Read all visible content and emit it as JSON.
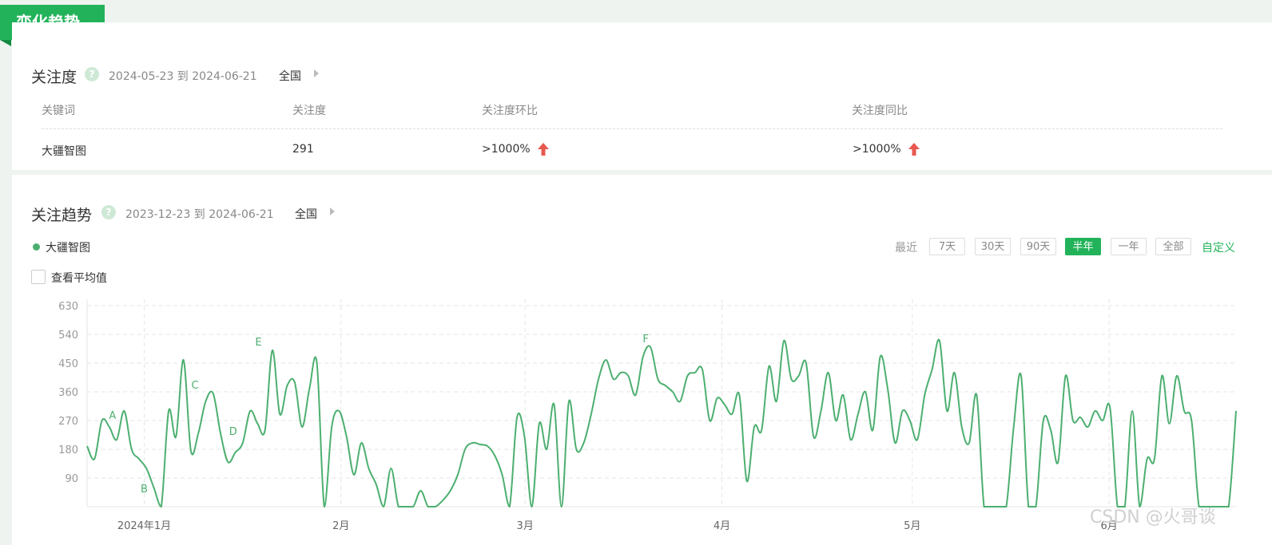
{
  "section_tag": "变化趋势",
  "attention": {
    "title": "关注度",
    "date_range": "2024-05-23 到 2024-06-21",
    "region": "全国",
    "columns": [
      "关键词",
      "关注度",
      "关注度环比",
      "关注度同比"
    ],
    "row": {
      "keyword": "大疆智图",
      "value": "291",
      "mom": ">1000%",
      "yoy": ">1000%"
    }
  },
  "trend": {
    "title": "关注趋势",
    "date_range": "2023-12-23 到 2024-06-21",
    "region": "全国",
    "legend": "大疆智图",
    "show_average_label": "查看平均值",
    "range_label": "最近",
    "range_buttons": [
      "7天",
      "30天",
      "90天",
      "半年",
      "一年",
      "全部"
    ],
    "active_range": "半年",
    "custom_label": "自定义"
  },
  "colors": {
    "brand": "#22b35a",
    "line": "#4caf70",
    "up_arrow": "#e8584f"
  },
  "watermark": "CSDN @火哥谈",
  "chart_data": {
    "type": "line",
    "x_range": [
      "2023-12-23",
      "2024-06-21"
    ],
    "ylim": [
      0,
      630
    ],
    "yticks": [
      90,
      180,
      270,
      360,
      450,
      540,
      630
    ],
    "xtick_labels": [
      {
        "date": "2024-01-01",
        "label": "2024年1月"
      },
      {
        "date": "2024-02-01",
        "label": "2月"
      },
      {
        "date": "2024-03-01",
        "label": "3月"
      },
      {
        "date": "2024-04-01",
        "label": "4月"
      },
      {
        "date": "2024-05-01",
        "label": "5月"
      },
      {
        "date": "2024-06-01",
        "label": "6月"
      }
    ],
    "grid": true,
    "series": [
      {
        "name": "大疆智图",
        "values": [
          190,
          150,
          270,
          250,
          210,
          300,
          180,
          150,
          120,
          60,
          0,
          300,
          220,
          460,
          175,
          230,
          330,
          355,
          230,
          140,
          170,
          200,
          300,
          260,
          240,
          490,
          290,
          380,
          390,
          250,
          370,
          450,
          0,
          250,
          300,
          220,
          100,
          200,
          120,
          70,
          0,
          120,
          0,
          0,
          0,
          50,
          0,
          0,
          20,
          50,
          100,
          180,
          200,
          195,
          190,
          160,
          100,
          0,
          280,
          220,
          0,
          260,
          180,
          320,
          0,
          330,
          180,
          200,
          290,
          400,
          460,
          400,
          420,
          410,
          350,
          470,
          500,
          400,
          380,
          360,
          330,
          410,
          420,
          430,
          270,
          340,
          320,
          290,
          350,
          80,
          250,
          240,
          440,
          330,
          520,
          400,
          410,
          450,
          220,
          300,
          420,
          270,
          350,
          210,
          290,
          360,
          240,
          470,
          370,
          200,
          300,
          270,
          210,
          350,
          430,
          520,
          300,
          420,
          250,
          200,
          350,
          0,
          0,
          0,
          0,
          250,
          410,
          0,
          0,
          270,
          240,
          140,
          410,
          270,
          280,
          250,
          300,
          270,
          310,
          0,
          0,
          300,
          0,
          150,
          150,
          410,
          260,
          410,
          300,
          270,
          0,
          0,
          0,
          0,
          0,
          300
        ]
      }
    ],
    "annotations": [
      {
        "label": "A",
        "x": "2023-12-27",
        "y": 260
      },
      {
        "label": "B",
        "x": "2024-01-01",
        "y": 30
      },
      {
        "label": "C",
        "x": "2024-01-09",
        "y": 355
      },
      {
        "label": "D",
        "x": "2024-01-15",
        "y": 210
      },
      {
        "label": "E",
        "x": "2024-01-19",
        "y": 490
      },
      {
        "label": "F",
        "x": "2024-03-20",
        "y": 500
      }
    ]
  }
}
